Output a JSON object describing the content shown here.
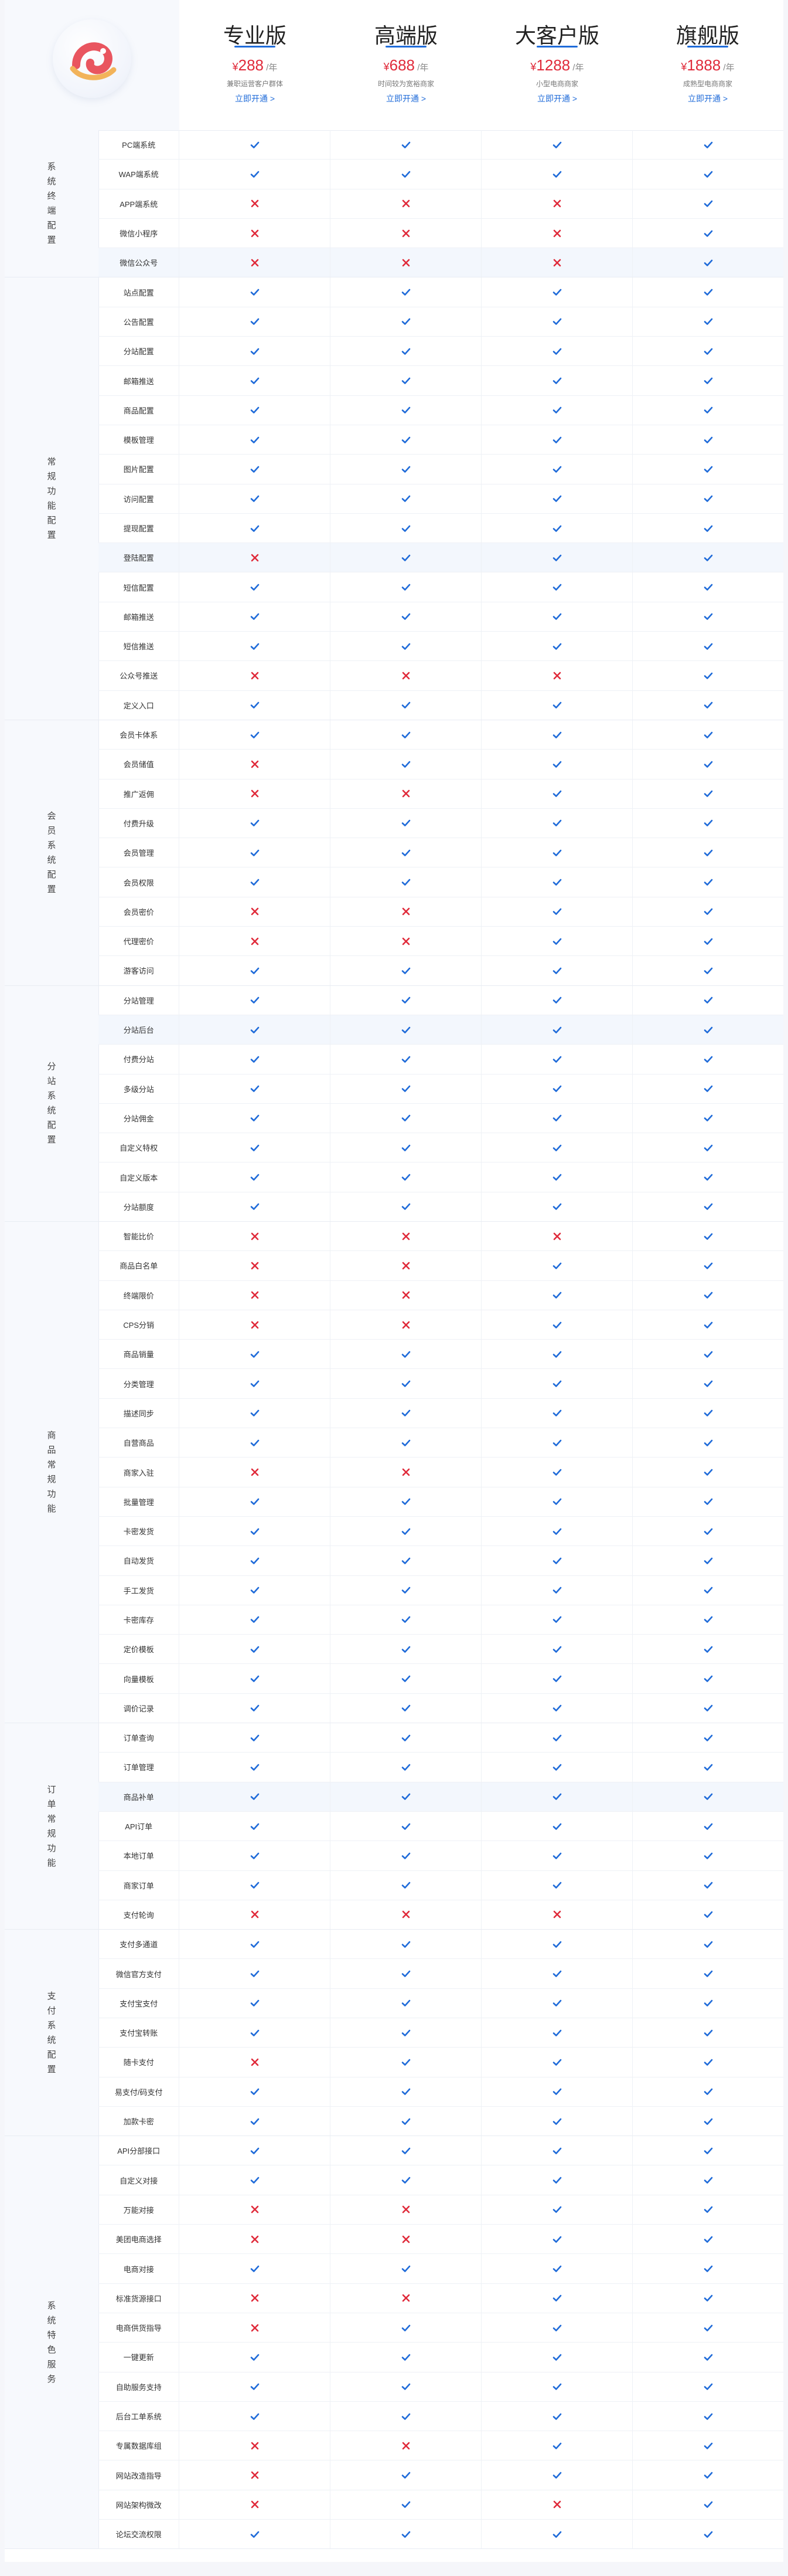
{
  "header": {
    "logo_icon": "logo-icon",
    "plans": [
      {
        "name": "专业版",
        "currency": "¥",
        "price": "288",
        "unit": "/年",
        "desc": "兼职运营客户群体",
        "open_label": "立即开通 >"
      },
      {
        "name": "高端版",
        "currency": "¥",
        "price": "688",
        "unit": "/年",
        "desc": "时间较为宽裕商家",
        "open_label": "立即开通 >"
      },
      {
        "name": "大客户版",
        "currency": "¥",
        "price": "1288",
        "unit": "/年",
        "desc": "小型电商商家",
        "open_label": "立即开通 >"
      },
      {
        "name": "旗舰版",
        "currency": "¥",
        "price": "1888",
        "unit": "/年",
        "desc": "成熟型电商商家",
        "open_label": "立即开通 >"
      }
    ]
  },
  "colors": {
    "check": "#1f6bd9",
    "cross": "#e02a3a",
    "accent": "#1f6bd9"
  },
  "sections": [
    {
      "title": "系统终端配置",
      "rows": [
        {
          "label": "PC端系统",
          "v": [
            1,
            1,
            1,
            1
          ]
        },
        {
          "label": "WAP端系统",
          "v": [
            1,
            1,
            1,
            1
          ]
        },
        {
          "label": "APP端系统",
          "v": [
            0,
            0,
            0,
            1
          ]
        },
        {
          "label": "微信小程序",
          "v": [
            0,
            0,
            0,
            1
          ]
        },
        {
          "label": "微信公众号",
          "v": [
            0,
            0,
            0,
            1
          ],
          "hl": true
        }
      ]
    },
    {
      "title": "常规功能配置",
      "rows": [
        {
          "label": "站点配置",
          "v": [
            1,
            1,
            1,
            1
          ]
        },
        {
          "label": "公告配置",
          "v": [
            1,
            1,
            1,
            1
          ]
        },
        {
          "label": "分站配置",
          "v": [
            1,
            1,
            1,
            1
          ]
        },
        {
          "label": "邮箱推送",
          "v": [
            1,
            1,
            1,
            1
          ]
        },
        {
          "label": "商品配置",
          "v": [
            1,
            1,
            1,
            1
          ]
        },
        {
          "label": "模板管理",
          "v": [
            1,
            1,
            1,
            1
          ]
        },
        {
          "label": "图片配置",
          "v": [
            1,
            1,
            1,
            1
          ]
        },
        {
          "label": "访问配置",
          "v": [
            1,
            1,
            1,
            1
          ]
        },
        {
          "label": "提现配置",
          "v": [
            1,
            1,
            1,
            1
          ]
        },
        {
          "label": "登陆配置",
          "v": [
            0,
            1,
            1,
            1
          ],
          "hl": true
        },
        {
          "label": "短信配置",
          "v": [
            1,
            1,
            1,
            1
          ]
        },
        {
          "label": "邮箱推送",
          "v": [
            1,
            1,
            1,
            1
          ]
        },
        {
          "label": "短信推送",
          "v": [
            1,
            1,
            1,
            1
          ]
        },
        {
          "label": "公众号推送",
          "v": [
            0,
            0,
            0,
            1
          ]
        },
        {
          "label": "定义入口",
          "v": [
            1,
            1,
            1,
            1
          ]
        }
      ]
    },
    {
      "title": "会员系统配置",
      "rows": [
        {
          "label": "会员卡体系",
          "v": [
            1,
            1,
            1,
            1
          ]
        },
        {
          "label": "会员储值",
          "v": [
            0,
            1,
            1,
            1
          ]
        },
        {
          "label": "推广返佣",
          "v": [
            0,
            0,
            1,
            1
          ]
        },
        {
          "label": "付费升级",
          "v": [
            1,
            1,
            1,
            1
          ]
        },
        {
          "label": "会员管理",
          "v": [
            1,
            1,
            1,
            1
          ]
        },
        {
          "label": "会员权限",
          "v": [
            1,
            1,
            1,
            1
          ]
        },
        {
          "label": "会员密价",
          "v": [
            0,
            0,
            1,
            1
          ]
        },
        {
          "label": "代理密价",
          "v": [
            0,
            0,
            1,
            1
          ]
        },
        {
          "label": "游客访问",
          "v": [
            1,
            1,
            1,
            1
          ]
        }
      ]
    },
    {
      "title": "分站系统配置",
      "rows": [
        {
          "label": "分站管理",
          "v": [
            1,
            1,
            1,
            1
          ]
        },
        {
          "label": "分站后台",
          "v": [
            1,
            1,
            1,
            1
          ],
          "hl": true
        },
        {
          "label": "付费分站",
          "v": [
            1,
            1,
            1,
            1
          ]
        },
        {
          "label": "多级分站",
          "v": [
            1,
            1,
            1,
            1
          ]
        },
        {
          "label": "分站佣金",
          "v": [
            1,
            1,
            1,
            1
          ]
        },
        {
          "label": "自定义特权",
          "v": [
            1,
            1,
            1,
            1
          ]
        },
        {
          "label": "自定义版本",
          "v": [
            1,
            1,
            1,
            1
          ]
        },
        {
          "label": "分站额度",
          "v": [
            1,
            1,
            1,
            1
          ]
        }
      ]
    },
    {
      "title": "商品常规功能",
      "rows": [
        {
          "label": "智能比价",
          "v": [
            0,
            0,
            0,
            1
          ]
        },
        {
          "label": "商品白名单",
          "v": [
            0,
            0,
            1,
            1
          ]
        },
        {
          "label": "终端限价",
          "v": [
            0,
            0,
            1,
            1
          ]
        },
        {
          "label": "CPS分销",
          "v": [
            0,
            0,
            1,
            1
          ]
        },
        {
          "label": "商品销量",
          "v": [
            1,
            1,
            1,
            1
          ]
        },
        {
          "label": "分类管理",
          "v": [
            1,
            1,
            1,
            1
          ]
        },
        {
          "label": "描述同步",
          "v": [
            1,
            1,
            1,
            1
          ]
        },
        {
          "label": "自营商品",
          "v": [
            1,
            1,
            1,
            1
          ]
        },
        {
          "label": "商家入驻",
          "v": [
            0,
            0,
            1,
            1
          ]
        },
        {
          "label": "批量管理",
          "v": [
            1,
            1,
            1,
            1
          ]
        },
        {
          "label": "卡密发货",
          "v": [
            1,
            1,
            1,
            1
          ]
        },
        {
          "label": "自动发货",
          "v": [
            1,
            1,
            1,
            1
          ]
        },
        {
          "label": "手工发货",
          "v": [
            1,
            1,
            1,
            1
          ]
        },
        {
          "label": "卡密库存",
          "v": [
            1,
            1,
            1,
            1
          ]
        },
        {
          "label": "定价模板",
          "v": [
            1,
            1,
            1,
            1
          ]
        },
        {
          "label": "向量模板",
          "v": [
            1,
            1,
            1,
            1
          ]
        },
        {
          "label": "调价记录",
          "v": [
            1,
            1,
            1,
            1
          ]
        }
      ]
    },
    {
      "title": "订单常规功能",
      "rows": [
        {
          "label": "订单查询",
          "v": [
            1,
            1,
            1,
            1
          ]
        },
        {
          "label": "订单管理",
          "v": [
            1,
            1,
            1,
            1
          ]
        },
        {
          "label": "商品补单",
          "v": [
            1,
            1,
            1,
            1
          ],
          "hl": true
        },
        {
          "label": "API订单",
          "v": [
            1,
            1,
            1,
            1
          ]
        },
        {
          "label": "本地订单",
          "v": [
            1,
            1,
            1,
            1
          ]
        },
        {
          "label": "商家订单",
          "v": [
            1,
            1,
            1,
            1
          ]
        },
        {
          "label": "支付轮询",
          "v": [
            0,
            0,
            0,
            1
          ]
        }
      ]
    },
    {
      "title": "支付系统配置",
      "rows": [
        {
          "label": "支付多通道",
          "v": [
            1,
            1,
            1,
            1
          ]
        },
        {
          "label": "微信官方支付",
          "v": [
            1,
            1,
            1,
            1
          ]
        },
        {
          "label": "支付宝支付",
          "v": [
            1,
            1,
            1,
            1
          ]
        },
        {
          "label": "支付宝转账",
          "v": [
            1,
            1,
            1,
            1
          ]
        },
        {
          "label": "随卡支付",
          "v": [
            0,
            1,
            1,
            1
          ]
        },
        {
          "label": "易支付/码支付",
          "v": [
            1,
            1,
            1,
            1
          ]
        },
        {
          "label": "加款卡密",
          "v": [
            1,
            1,
            1,
            1
          ]
        }
      ]
    },
    {
      "title": "系统特色服务",
      "rows": [
        {
          "label": "API分部接口",
          "v": [
            1,
            1,
            1,
            1
          ]
        },
        {
          "label": "自定义对接",
          "v": [
            1,
            1,
            1,
            1
          ]
        },
        {
          "label": "万能对接",
          "v": [
            0,
            0,
            1,
            1
          ]
        },
        {
          "label": "美团电商选择",
          "v": [
            0,
            0,
            1,
            1
          ]
        },
        {
          "label": "电商对接",
          "v": [
            1,
            1,
            1,
            1
          ]
        },
        {
          "label": "标准货源接口",
          "v": [
            0,
            0,
            1,
            1
          ]
        },
        {
          "label": "电商供货指导",
          "v": [
            0,
            1,
            1,
            1
          ]
        },
        {
          "label": "一键更新",
          "v": [
            1,
            1,
            1,
            1
          ]
        },
        {
          "label": "自助服务支持",
          "v": [
            1,
            1,
            1,
            1
          ]
        },
        {
          "label": "后台工单系统",
          "v": [
            1,
            1,
            1,
            1
          ]
        },
        {
          "label": "专属数据库组",
          "v": [
            0,
            0,
            1,
            1
          ]
        },
        {
          "label": "网站改造指导",
          "v": [
            0,
            1,
            1,
            1
          ]
        },
        {
          "label": "网站架构微改",
          "v": [
            0,
            1,
            0,
            1
          ]
        },
        {
          "label": "论坛交流权限",
          "v": [
            1,
            1,
            1,
            1
          ]
        }
      ]
    }
  ]
}
